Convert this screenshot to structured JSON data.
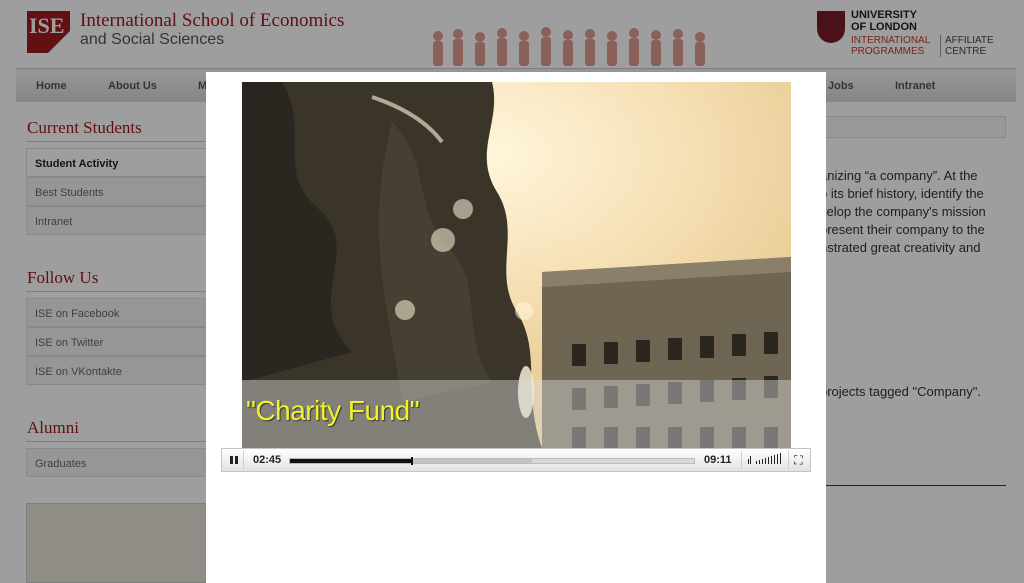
{
  "header": {
    "logo_text": "ISE",
    "school_name": "International School of Economics",
    "school_sub": "and Social Sciences",
    "partner_line1": "UNIVERSITY",
    "partner_line2": "OF LONDON",
    "partner_line3": "INTERNATIONAL",
    "partner_line4": "PROGRAMMES",
    "partner_line5": "AFFILIATE",
    "partner_line6": "CENTRE"
  },
  "nav": {
    "items": [
      "Home",
      "About Us",
      "M",
      "Jobs",
      "Intranet"
    ]
  },
  "sidebar": {
    "current_students": {
      "heading": "Current Students",
      "items": [
        "Student Activity",
        "Best Students",
        "Intranet"
      ]
    },
    "follow_us": {
      "heading": "Follow Us",
      "items": [
        "ISE on Facebook",
        "ISE on Twitter",
        "ISE on VKontakte"
      ]
    },
    "alumni": {
      "heading": "Alumni",
      "items": [
        "Graduates"
      ]
    }
  },
  "main": {
    "text_lines": [
      "anizing “a company”. At the",
      "p its brief history, identify the",
      "velop the company's mission",
      "present their company to the",
      "nstrated great creativity and"
    ],
    "tagged_text": "projects tagged \"Company\"."
  },
  "player": {
    "caption": "\"Charity Fund\"",
    "current_time": "02:45",
    "duration": "09:11",
    "played_fraction": 0.3,
    "buffered_fraction": 0.6
  },
  "colors": {
    "brand": "#9e1b20",
    "caption": "#f2f22a"
  },
  "icons": {
    "pause": "pause-icon",
    "volume": "volume-icon",
    "fullscreen": "fullscreen-icon"
  }
}
